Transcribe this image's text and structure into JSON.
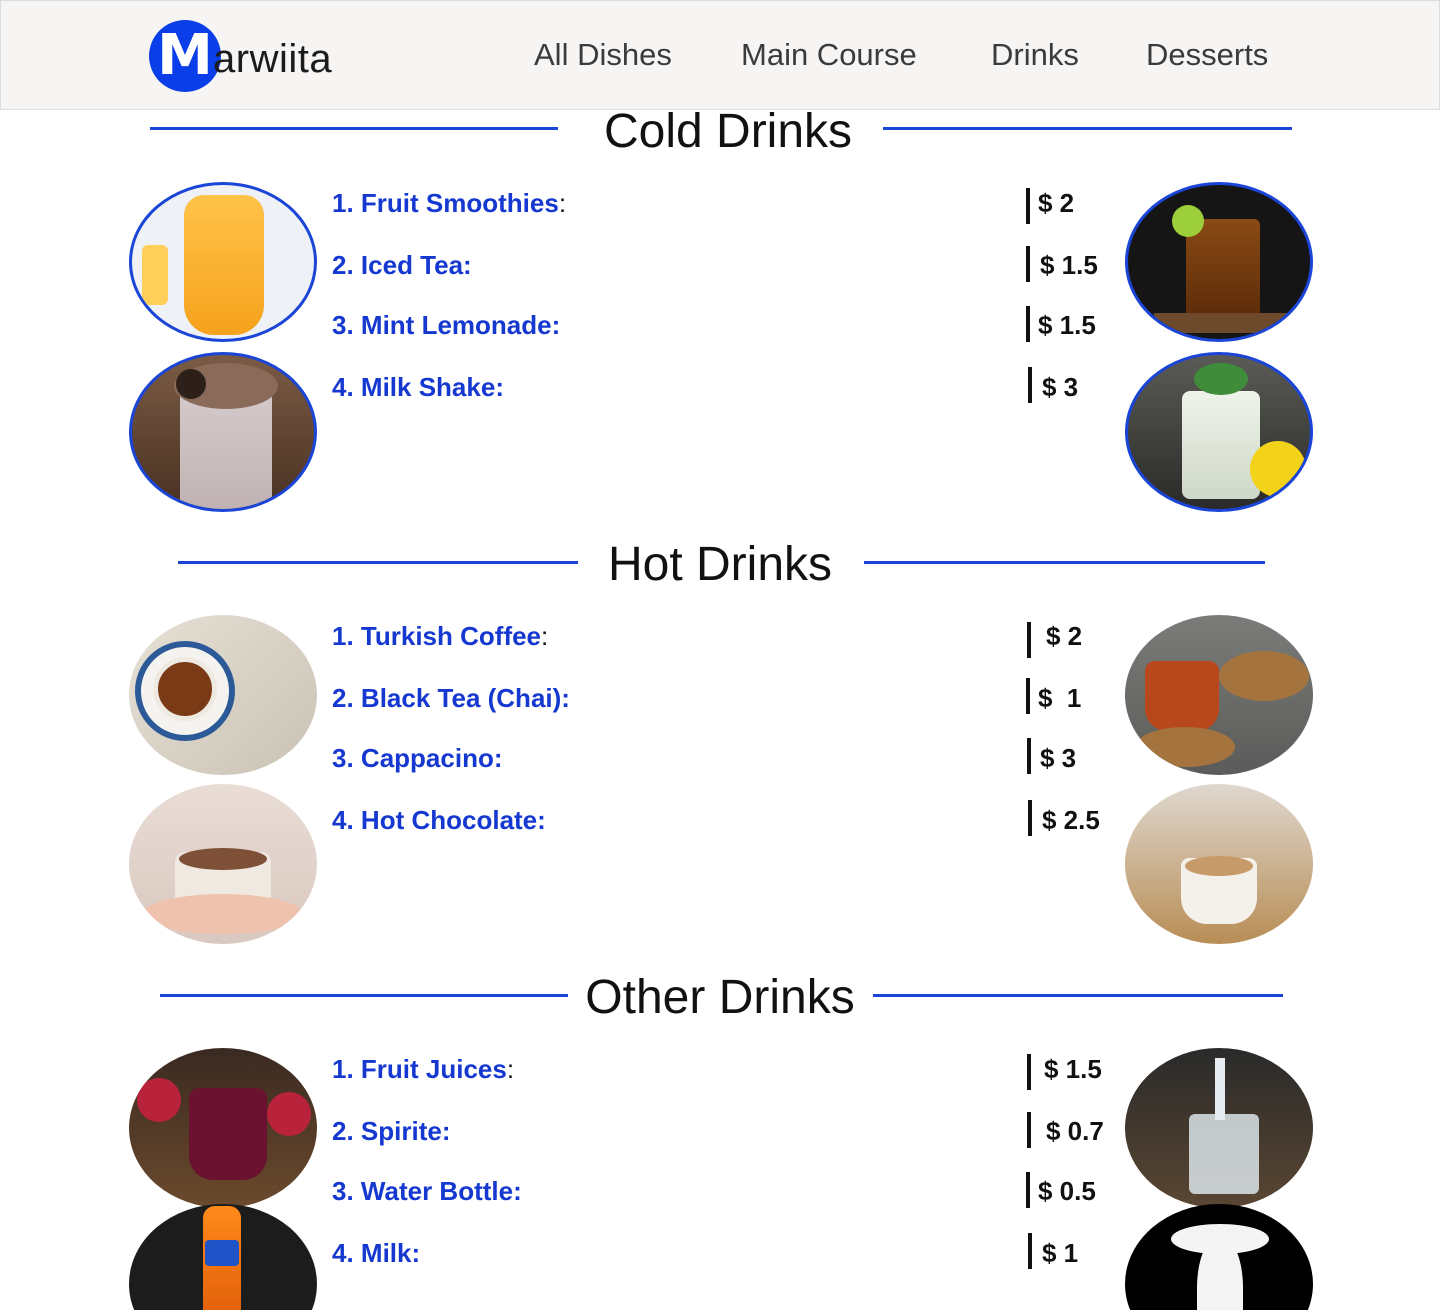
{
  "brand": {
    "initial": "M",
    "rest": "arwiita"
  },
  "nav": [
    "All Dishes",
    "Main Course",
    "Drinks",
    "Desserts"
  ],
  "sections": [
    {
      "title": "Cold Drinks",
      "items": [
        {
          "number": "1.",
          "name": "Fruit Smoothies",
          "colon": ":",
          "price": "$ 2"
        },
        {
          "number": "2.",
          "name": "Iced Tea:",
          "colon": "",
          "price": "$ 1.5"
        },
        {
          "number": "3.",
          "name": "Mint Lemonade:",
          "colon": "",
          "price": "$ 1.5"
        },
        {
          "number": "4.",
          "name": "Milk Shake:",
          "colon": "",
          "price": "$ 3"
        }
      ],
      "images": [
        "fruit-smoothie-photo",
        "iced-tea-photo",
        "milkshake-photo",
        "mint-lemonade-photo"
      ]
    },
    {
      "title": "Hot Drinks",
      "items": [
        {
          "number": "1.",
          "name": "Turkish Coffee",
          "colon": ":",
          "price": "$ 2"
        },
        {
          "number": "2.",
          "name": "Black Tea (Chai):",
          "colon": "",
          "price": "$  1"
        },
        {
          "number": "3.",
          "name": "Cappacino:",
          "colon": "",
          "price": "$ 3"
        },
        {
          "number": "4.",
          "name": "Hot Chocolate:",
          "colon": "",
          "price": "$ 2.5"
        }
      ],
      "images": [
        "turkish-coffee-photo",
        "black-tea-photo",
        "hot-chocolate-photo",
        "cappuccino-photo"
      ]
    },
    {
      "title": "Other Drinks",
      "items": [
        {
          "number": "1.",
          "name": "Fruit Juices",
          "colon": ":",
          "price": "$ 1.5"
        },
        {
          "number": "2.",
          "name": "Spirite:",
          "colon": "",
          "price": "$ 0.7"
        },
        {
          "number": "3.",
          "name": "Water Bottle:",
          "colon": "",
          "price": "$ 0.5"
        },
        {
          "number": "4.",
          "name": "Milk:",
          "colon": "",
          "price": "$ 1"
        }
      ],
      "images": [
        "fruit-juice-photo",
        "water-glass-photo",
        "soda-bottle-photo",
        "milk-splash-photo"
      ]
    }
  ],
  "colors": {
    "accent": "#1a45d6",
    "item_text": "#1538d0",
    "nav_bg": "#f7f5f3"
  }
}
